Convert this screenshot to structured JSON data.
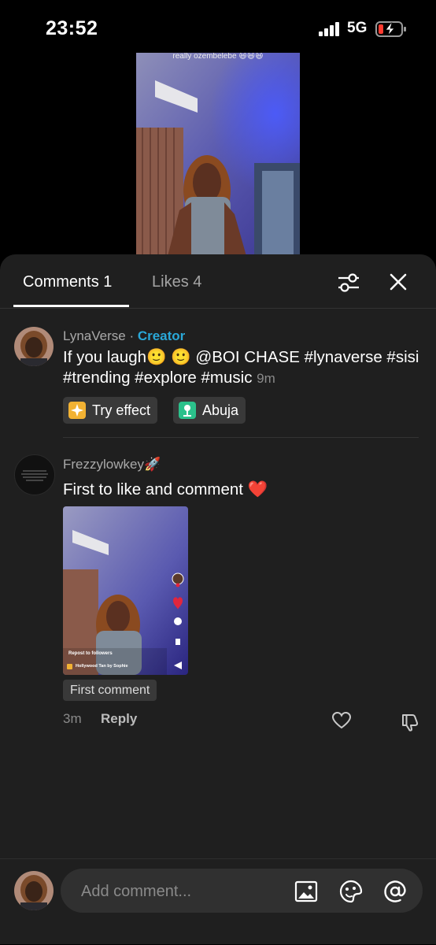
{
  "status": {
    "time": "23:52",
    "network": "5G"
  },
  "video": {
    "caption": "really ozembelebe 😆😆😆"
  },
  "tabs": {
    "comments": "Comments 1",
    "likes": "Likes 4"
  },
  "comments": [
    {
      "author": "LynaVerse",
      "separator": " · ",
      "badge": "Creator",
      "text": "If you laugh🙂 🙂 @BOI CHASE  #lynaverse #sisi #trending #explore #music",
      "time": "9m",
      "chips": [
        "Try effect",
        "Abuja"
      ]
    },
    {
      "author": "Frezzylowkey🚀",
      "text": "First to like and comment ❤️",
      "image_overlay": {
        "repost": "Repost to followers",
        "music": "Hollywood Tan by Sophie"
      },
      "tag": "First comment",
      "time": "3m",
      "reply_label": "Reply"
    }
  ],
  "composer": {
    "placeholder": "Add comment..."
  },
  "colors": {
    "sheet_background": "#1f1f1f",
    "creator_badge": "#2aa8d8",
    "heart": "#e2263d"
  }
}
